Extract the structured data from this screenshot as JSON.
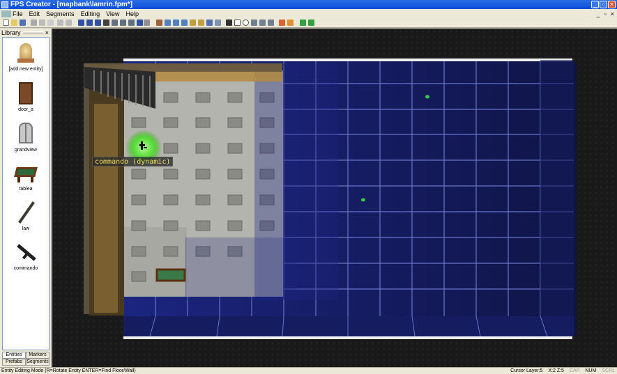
{
  "window": {
    "title": "FPS Creator - [mapbank\\lamrin.fpm*]",
    "controls": [
      "_",
      "▫",
      "✕"
    ]
  },
  "menu": {
    "items": [
      "File",
      "Edit",
      "Segments",
      "Editing",
      "View",
      "Help"
    ],
    "mdi_controls": [
      "_",
      "▫",
      "×"
    ]
  },
  "library": {
    "title": "Library",
    "close": "×",
    "entities": [
      {
        "label": "[add new entity]",
        "icon": "add-entity-icon"
      },
      {
        "label": "door_a",
        "icon": "door-icon"
      },
      {
        "label": "grandview",
        "icon": "window-icon"
      },
      {
        "label": "tablea",
        "icon": "table-icon"
      },
      {
        "label": "law",
        "icon": "baton-icon"
      },
      {
        "label": "commando",
        "icon": "rifle-icon"
      }
    ],
    "tabs_top": [
      "Entities",
      "Markers"
    ],
    "tabs_bottom": [
      "Prefabs",
      "Segments"
    ]
  },
  "viewport": {
    "entity_tooltip": "commando (dynamic)",
    "grid_color": "#1c2580",
    "floor_color": "#b8b8b4"
  },
  "status": {
    "mode": "Entity Editing Mode (R=Rotate Entity  ENTER=Find Floor/Wall)",
    "cursor_layer": "Cursor Layer:5",
    "coords": "X:2  Z:5",
    "cap": "CAP",
    "num": "NUM",
    "scrl": "SCRL"
  }
}
